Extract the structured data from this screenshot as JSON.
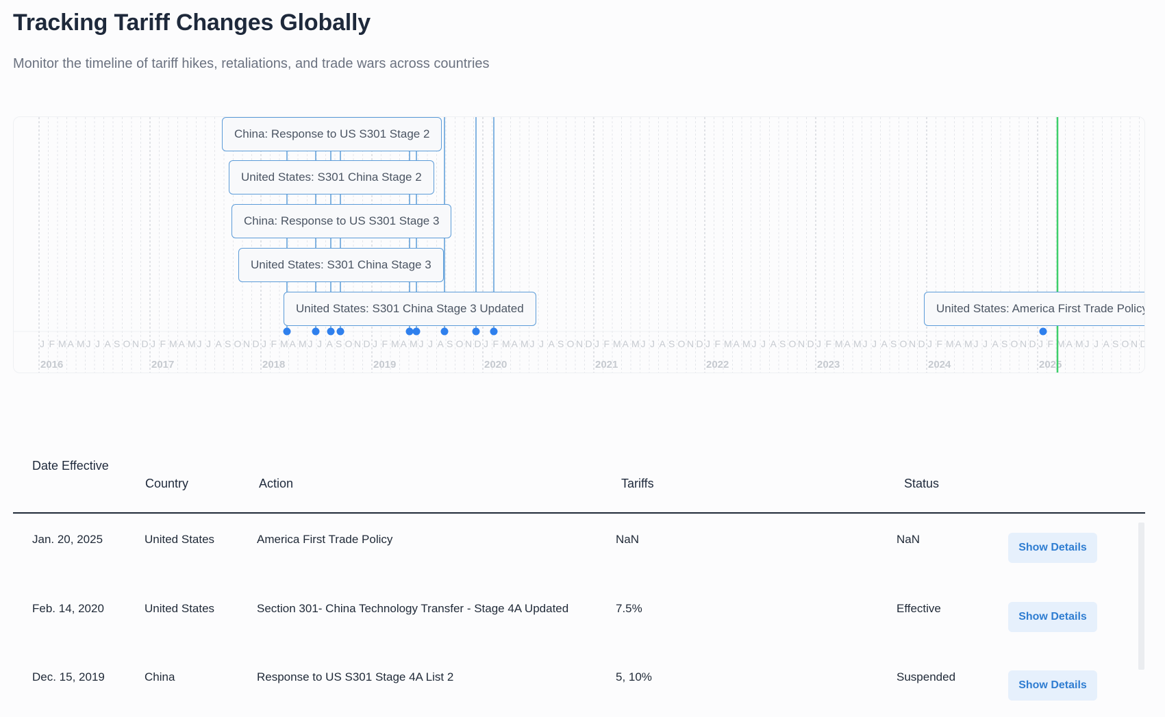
{
  "header": {
    "title": "Tracking Tariff Changes Globally",
    "subtitle": "Monitor the timeline of tariff hikes, retaliations, and trade wars across countries"
  },
  "timeline": {
    "years": [
      "2016",
      "2017",
      "2018",
      "2019",
      "2020",
      "2021",
      "2022",
      "2023",
      "2024",
      "2025"
    ],
    "month_letters": [
      "J",
      "F",
      "M",
      "A",
      "M",
      "J",
      "J",
      "A",
      "S",
      "O",
      "N",
      "D"
    ],
    "event_labels": [
      "China: Response to US S301 Stage 2",
      "United States: S301 China Stage 2",
      "China: Response to US S301 Stage 3",
      "United States: S301 China Stage 3",
      "United States: S301 China Stage 3 Updated",
      "United States: America First Trade Policy"
    ],
    "colors": {
      "accent": "#2f80ed",
      "line": "#5b9bd8",
      "today": "#3ecf6b"
    }
  },
  "table": {
    "headers": {
      "date": "Date Effective",
      "country": "Country",
      "action": "Action",
      "tariffs": "Tariffs",
      "status": "Status"
    },
    "rows": [
      {
        "date": "Jan. 20, 2025",
        "country": "United States",
        "action": "America First Trade Policy",
        "tariffs": "NaN",
        "status": "NaN",
        "button": "Show Details"
      },
      {
        "date": "Feb. 14, 2020",
        "country": "United States",
        "action": "Section 301- China Technology Transfer - Stage 4A Updated",
        "tariffs": "7.5%",
        "status": "Effective",
        "button": "Show Details"
      },
      {
        "date": "Dec. 15, 2019",
        "country": "China",
        "action": "Response to US S301 Stage 4A List 2",
        "tariffs": "5, 10%",
        "status": "Suspended",
        "button": "Show Details"
      }
    ]
  }
}
